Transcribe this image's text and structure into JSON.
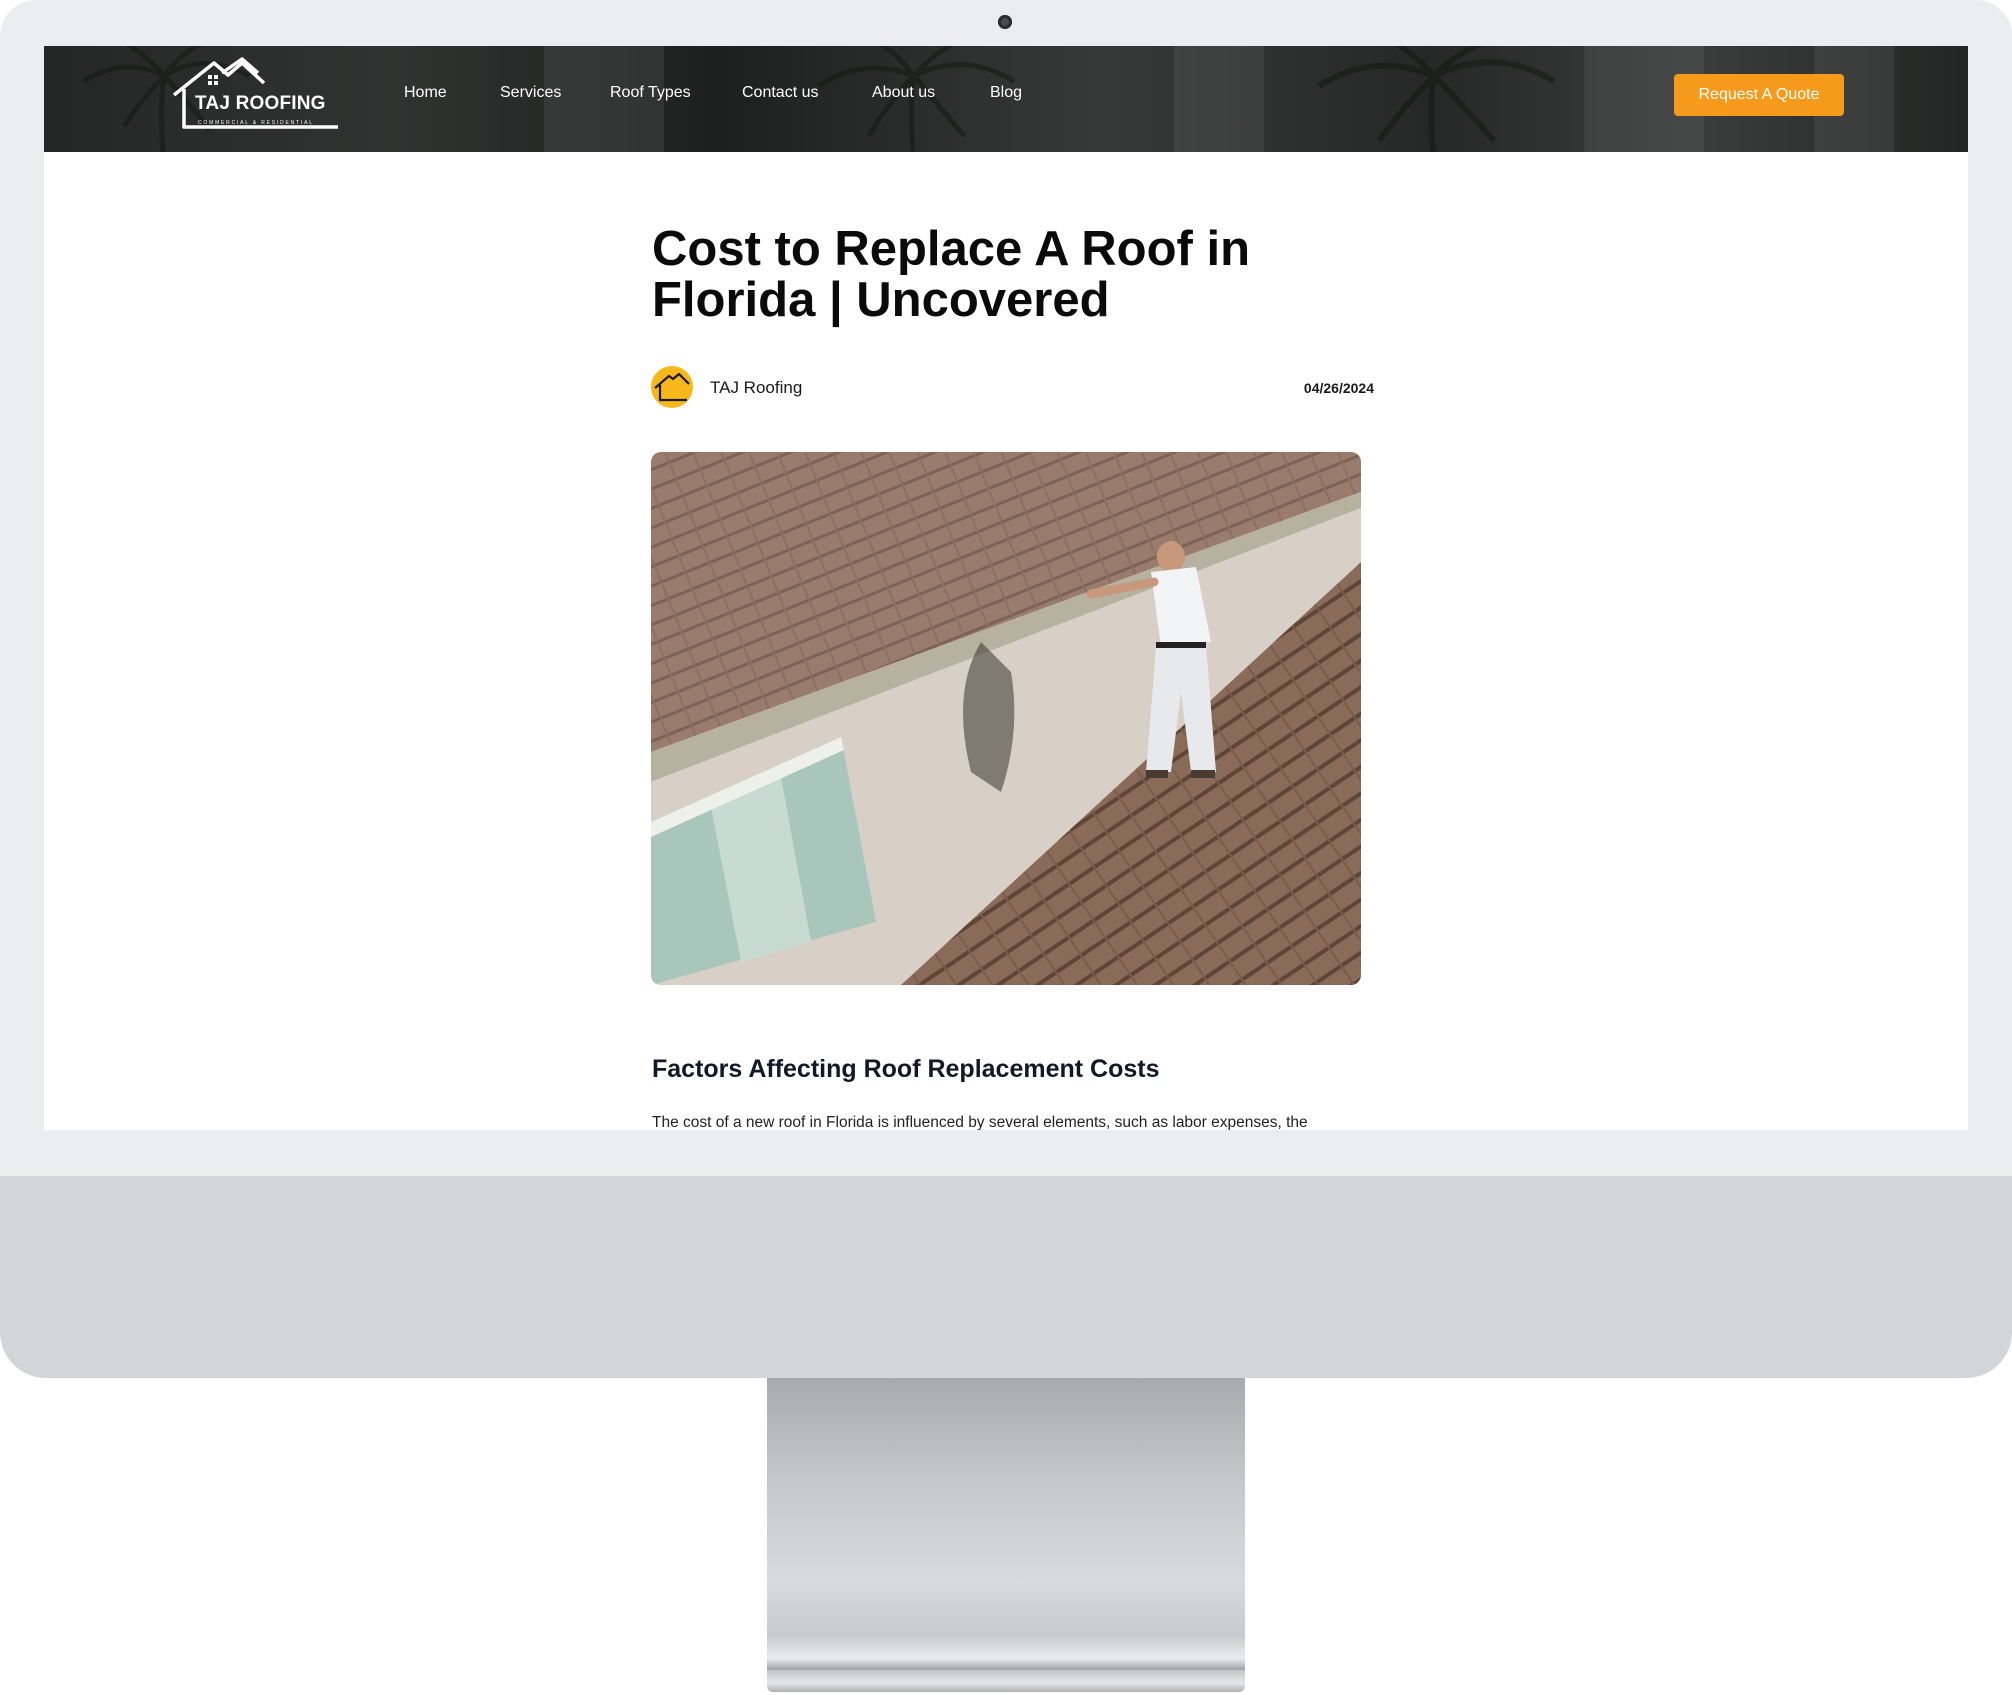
{
  "brand": {
    "logo_text": "TAJ ROOFING",
    "logo_tagline": "COMMERCIAL & RESIDENTIAL"
  },
  "nav": {
    "items": [
      {
        "label": "Home"
      },
      {
        "label": "Services"
      },
      {
        "label": "Roof Types"
      },
      {
        "label": "Contact us"
      },
      {
        "label": "About us"
      },
      {
        "label": "Blog"
      }
    ],
    "cta_label": "Request A Quote"
  },
  "article": {
    "title": "Cost to Replace A Roof in Florida | Uncovered",
    "author": "TAJ Roofing",
    "date": "04/26/2024",
    "section_heading": "Factors Affecting Roof Replacement Costs",
    "paragraph": "The cost of a new roof in Florida is influenced by several elements, such as labor expenses, the"
  },
  "colors": {
    "accent": "#f59a1b",
    "avatar": "#f7b81c",
    "heading": "#0a0a0a"
  },
  "icons": {
    "logo": "house-roof-logo",
    "avatar": "house-roof-avatar",
    "camera": "webcam-dot"
  }
}
